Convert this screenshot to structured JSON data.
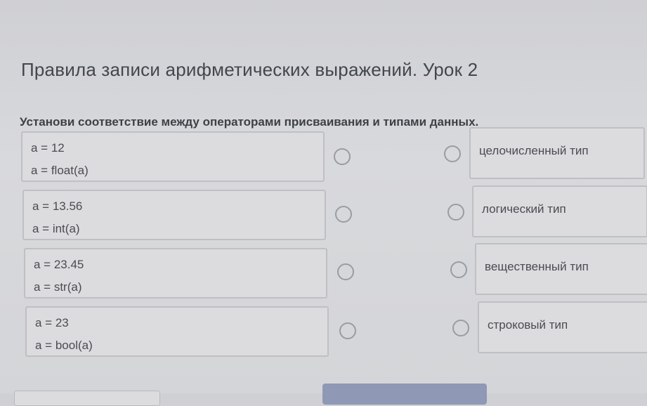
{
  "header": {
    "title": "Правила записи арифметических выражений. Урок 2"
  },
  "question": {
    "instruction": "Установи соответствие между операторами присваивания и типами данных."
  },
  "left_items": [
    {
      "line1": "a = 12",
      "line2": "a = float(a)"
    },
    {
      "line1": "a = 13.56",
      "line2": "a = int(a)"
    },
    {
      "line1": "a = 23.45",
      "line2": "a = str(a)"
    },
    {
      "line1": "a = 23",
      "line2": "a = bool(a)"
    }
  ],
  "right_items": [
    {
      "label": "целочисленный тип"
    },
    {
      "label": "логический тип"
    },
    {
      "label": "вещественный тип"
    },
    {
      "label": "строковый тип"
    }
  ]
}
